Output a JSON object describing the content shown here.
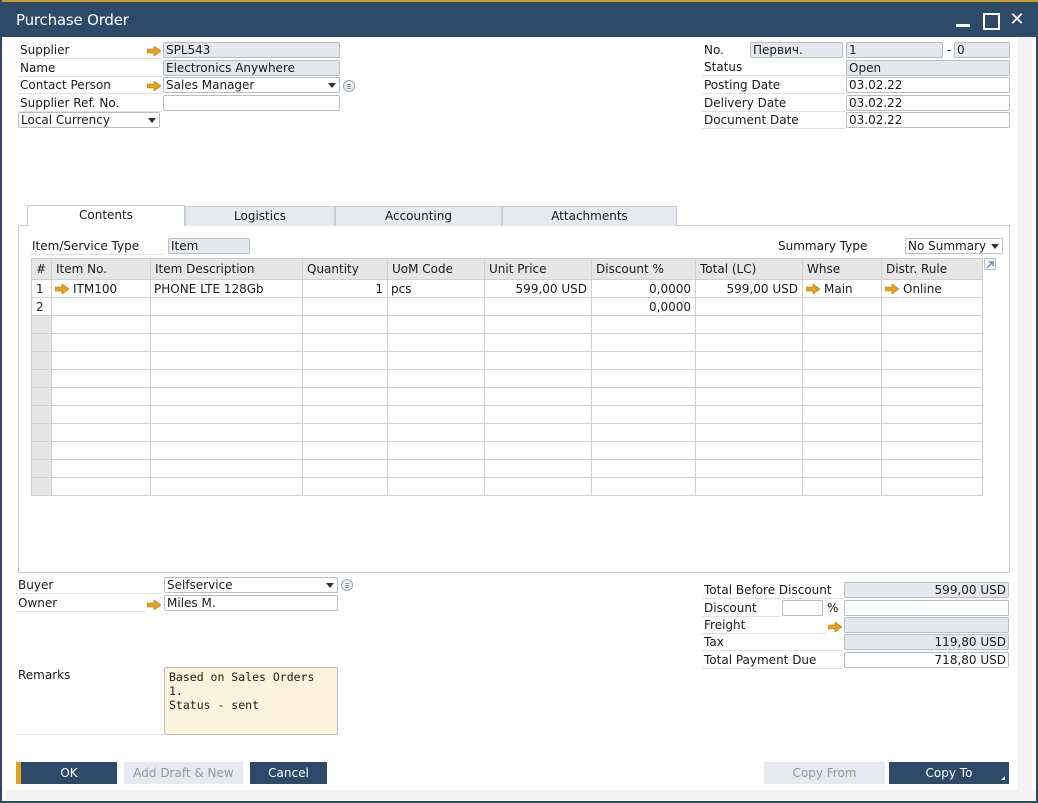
{
  "window": {
    "title": "Purchase Order",
    "controls": {
      "minimize": "minimize",
      "maximize": "maximize",
      "close": "✕"
    }
  },
  "header_left": {
    "supplier": {
      "label": "Supplier",
      "value": "SPL543"
    },
    "name": {
      "label": "Name",
      "value": "Electronics Anywhere"
    },
    "contact_person": {
      "label": "Contact Person",
      "value": "Sales Manager"
    },
    "supplier_ref": {
      "label": "Supplier Ref. No.",
      "value": ""
    },
    "currency": {
      "value": "Local Currency"
    }
  },
  "header_right": {
    "no": {
      "label": "No.",
      "series": "Первич.",
      "number": "1",
      "separator": "-",
      "suffix": "0"
    },
    "status": {
      "label": "Status",
      "value": "Open"
    },
    "posting_date": {
      "label": "Posting Date",
      "value": "03.02.22"
    },
    "delivery_date": {
      "label": "Delivery Date",
      "value": "03.02.22"
    },
    "document_date": {
      "label": "Document Date",
      "value": "03.02.22"
    }
  },
  "tabs": [
    {
      "label": "Contents",
      "active": true
    },
    {
      "label": "Logistics",
      "active": false
    },
    {
      "label": "Accounting",
      "active": false
    },
    {
      "label": "Attachments",
      "active": false
    }
  ],
  "contents": {
    "item_service_type": {
      "label": "Item/Service Type",
      "value": "Item"
    },
    "summary_type": {
      "label": "Summary Type",
      "value": "No Summary"
    },
    "columns": [
      "#",
      "Item No.",
      "Item Description",
      "Quantity",
      "UoM Code",
      "Unit Price",
      "Discount %",
      "Total (LC)",
      "Whse",
      "Distr. Rule"
    ],
    "rows": [
      {
        "num": "1",
        "item_no": "ITM100",
        "description": "PHONE LTE 128Gb",
        "quantity": "1",
        "uom": "pcs",
        "unit_price": "599,00 USD",
        "discount": "0,0000",
        "total": "599,00 USD",
        "whse": "Main",
        "distr_rule": "Online"
      },
      {
        "num": "2",
        "item_no": "",
        "description": "",
        "quantity": "",
        "uom": "",
        "unit_price": "",
        "discount": "0,0000",
        "total": "",
        "whse": "",
        "distr_rule": ""
      }
    ],
    "empty_rows": 10
  },
  "footer_left": {
    "buyer": {
      "label": "Buyer",
      "value": "Selfservice"
    },
    "owner": {
      "label": "Owner",
      "value": "Miles M."
    },
    "remarks": {
      "label": "Remarks",
      "value": "Based on Sales Orders 1.\nStatus - sent"
    }
  },
  "totals": {
    "total_before_discount": {
      "label": "Total Before Discount",
      "value": "599,00 USD"
    },
    "discount": {
      "label": "Discount",
      "percent": "",
      "percent_sign": "%",
      "value": ""
    },
    "freight": {
      "label": "Freight",
      "value": ""
    },
    "tax": {
      "label": "Tax",
      "value": "119,80 USD"
    },
    "total_payment_due": {
      "label": "Total Payment Due",
      "value": "718,80 USD"
    }
  },
  "buttons": {
    "ok": "OK",
    "add_draft_new": "Add Draft & New",
    "cancel": "Cancel",
    "copy_from": "Copy From",
    "copy_to": "Copy To"
  },
  "colors": {
    "titlebar": "#2d4a69",
    "accent_gold": "#e0a021",
    "readonly_field": "#e5e9ee",
    "remarks_bg": "#fdf3dc"
  }
}
